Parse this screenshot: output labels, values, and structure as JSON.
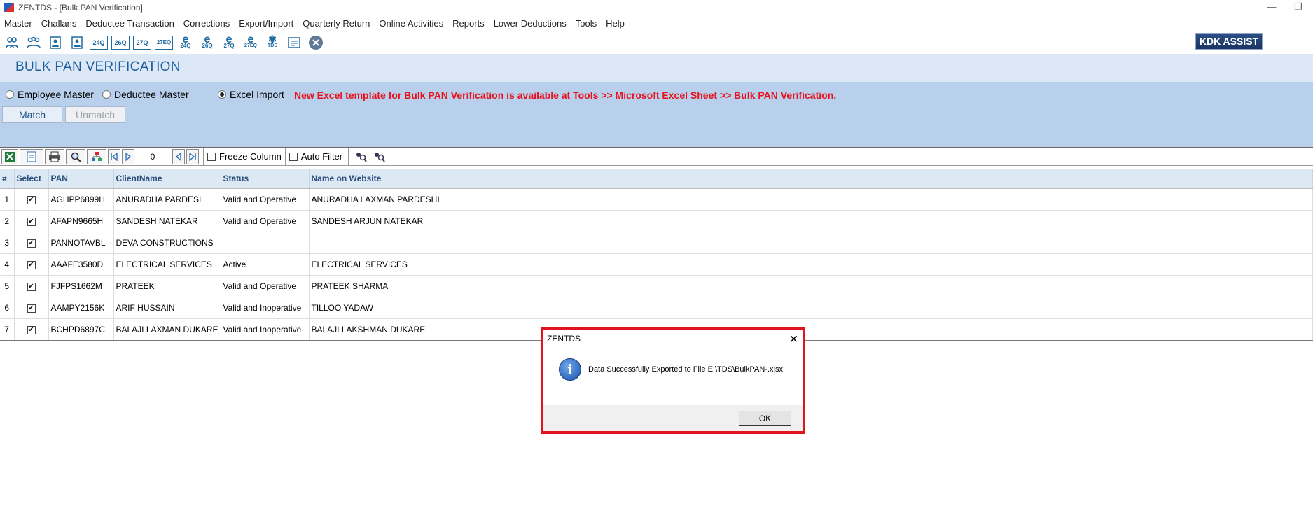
{
  "window": {
    "title": "ZENTDS - [Bulk PAN Verification]",
    "minimize": "—",
    "restore": "❐"
  },
  "menu": [
    "Master",
    "Challans",
    "Deductee Transaction",
    "Corrections",
    "Export/Import",
    "Quarterly Return",
    "Online Activities",
    "Reports",
    "Lower Deductions",
    "Tools",
    "Help"
  ],
  "toolbar": {
    "icons": [
      "users-icon",
      "group-icon",
      "form-24q-icon",
      "form-26q-icon",
      "form-24q-doc-icon",
      "form-26q-doc-icon",
      "form-27q-doc-icon",
      "form-27eq-doc-icon",
      "e-24q-icon",
      "e-26q-icon",
      "e-27q-icon",
      "e-27eq-icon",
      "tds-icon",
      "certificate-icon",
      "close-icon"
    ],
    "labels": [
      "",
      "",
      "",
      "",
      "24Q",
      "26Q",
      "27Q",
      "27EQ",
      "24Q",
      "26Q",
      "27Q",
      "27EQ",
      "TDS",
      "",
      ""
    ],
    "kdk_label": "KDK ASSIST"
  },
  "page": {
    "title": "BULK PAN VERIFICATION"
  },
  "options": {
    "employee_master": "Employee Master",
    "deductee_master": "Deductee Master",
    "excel_import": "Excel Import",
    "selected": "excel_import",
    "notice": "New Excel template for Bulk PAN Verification is available at Tools >> Microsoft Excel Sheet >> Bulk PAN Verification.",
    "match_label": "Match",
    "unmatch_label": "Unmatch"
  },
  "grid_toolbar": {
    "record_count": "0",
    "freeze_column": "Freeze Column",
    "auto_filter": "Auto Filter"
  },
  "table": {
    "headers": [
      "#",
      "Select",
      "PAN",
      "ClientName",
      "Status",
      "Name on Website"
    ],
    "rows": [
      {
        "no": "1",
        "pan": "AGHPP6899H",
        "client": "ANURADHA PARDESI",
        "status": "Valid and Operative",
        "website": "ANURADHA LAXMAN PARDESHI"
      },
      {
        "no": "2",
        "pan": "AFAPN9665H",
        "client": "SANDESH NATEKAR",
        "status": "Valid and Operative",
        "website": "SANDESH ARJUN NATEKAR"
      },
      {
        "no": "3",
        "pan": "PANNOTAVBL",
        "client": "DEVA CONSTRUCTIONS",
        "status": "",
        "website": ""
      },
      {
        "no": "4",
        "pan": "AAAFE3580D",
        "client": "ELECTRICAL SERVICES",
        "status": "Active",
        "website": "ELECTRICAL SERVICES"
      },
      {
        "no": "5",
        "pan": "FJFPS1662M",
        "client": "PRATEEK",
        "status": "Valid and Operative",
        "website": "PRATEEK SHARMA"
      },
      {
        "no": "6",
        "pan": "AAMPY2156K",
        "client": "ARIF HUSSAIN",
        "status": "Valid and Inoperative",
        "website": "TILLOO YADAW"
      },
      {
        "no": "7",
        "pan": "BCHPD6897C",
        "client": "BALAJI LAXMAN DUKARE",
        "status": "Valid and Inoperative",
        "website": "BALAJI LAKSHMAN DUKARE"
      }
    ]
  },
  "dialog": {
    "title": "ZENTDS",
    "message": "Data Successfully Exported to File E:\\TDS\\BulkPAN-.xlsx",
    "ok_label": "OK",
    "close_glyph": "✕",
    "info_glyph": "i"
  }
}
